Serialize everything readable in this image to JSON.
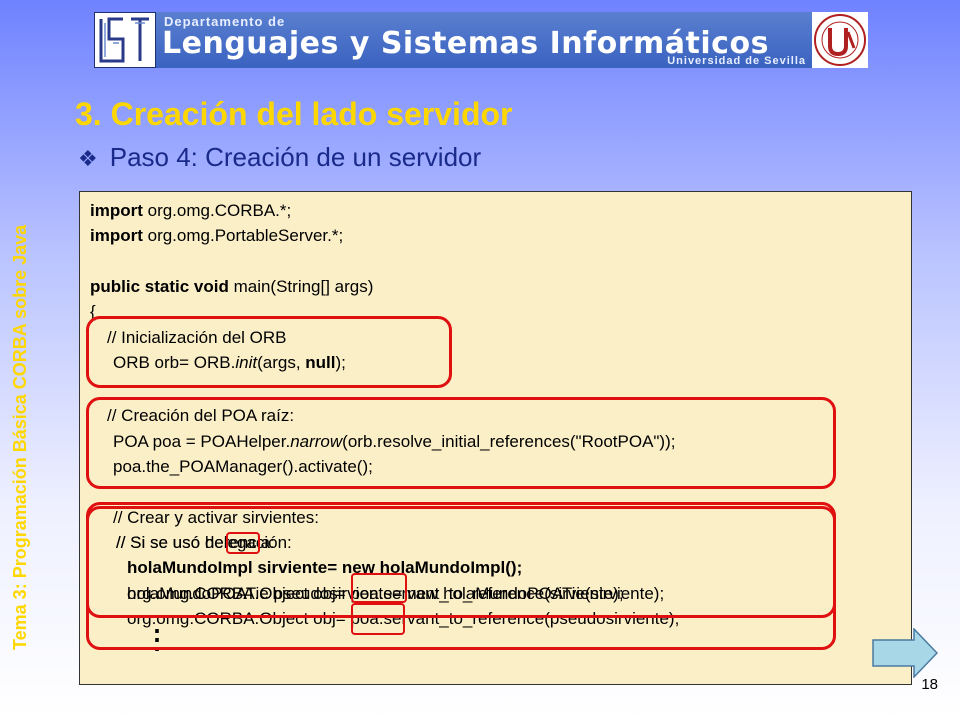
{
  "banner": {
    "dept_label": "Departamento de",
    "title": "Lenguajes y Sistemas Informáticos",
    "university": "Universidad de Sevilla"
  },
  "side_title": {
    "part1": "Tema 3: Programación Básica CORBA sobre Java"
  },
  "heading": "3. Creación del lado servidor",
  "subheading": {
    "bullet": "❖",
    "text": "Paso 4: Creación de un servidor"
  },
  "code": {
    "import1_kw": "import",
    "import1_rest": " org.omg.CORBA.*;",
    "import2_kw": "import",
    "import2_rest": " org.omg.PortableServer.*;",
    "main_kw": "public static void",
    "main_rest": " main(String[] args)",
    "brace": "{",
    "orb_comment": "// Inicialización del ORB",
    "orb_line_a": "ORB orb= ORB.",
    "orb_line_b": "init",
    "orb_line_c": "(args, ",
    "orb_line_d": "null",
    "orb_line_e": ");",
    "poa_comment": "// Creación del POA raíz:",
    "poa_line1_a": "POA poa = POAHelper.",
    "poa_line1_b": "narrow",
    "poa_line1_c": "(orb.resolve_initial_references(\"RootPOA\"));",
    "poa_line2": "poa.the_POAManager().activate();",
    "serv_comment": "// Crear y activar sirvientes:",
    "overlap1_a": "// Si se usó herencia:",
    "overlap1_b": "// Si se usó delegación:",
    "serv_line": "holaMundoImpl sirviente= new holaMundoImpl();",
    "overlap2_a": "org.omg.CORBA.Object obj= poa.servant_to_reference(sirviente);",
    "overlap2_b": "holaMundoPOATie pseudosirviente= new holaMundoPOATie(sirviente);",
    "obj_line": "org.omg.CORBA.Object obj= poa.servant_to_reference(pseudosirviente);",
    "dots": "⋮"
  },
  "page_number": "18",
  "colors": {
    "heading": "#ffd700",
    "subheading": "#1a2a8a",
    "code_bg": "#fbefc8",
    "highlight": "#e01010",
    "arrow": "#a8d8e8"
  },
  "icons": {
    "next": "right-arrow-icon",
    "bullet": "diamond-bullet-icon"
  }
}
